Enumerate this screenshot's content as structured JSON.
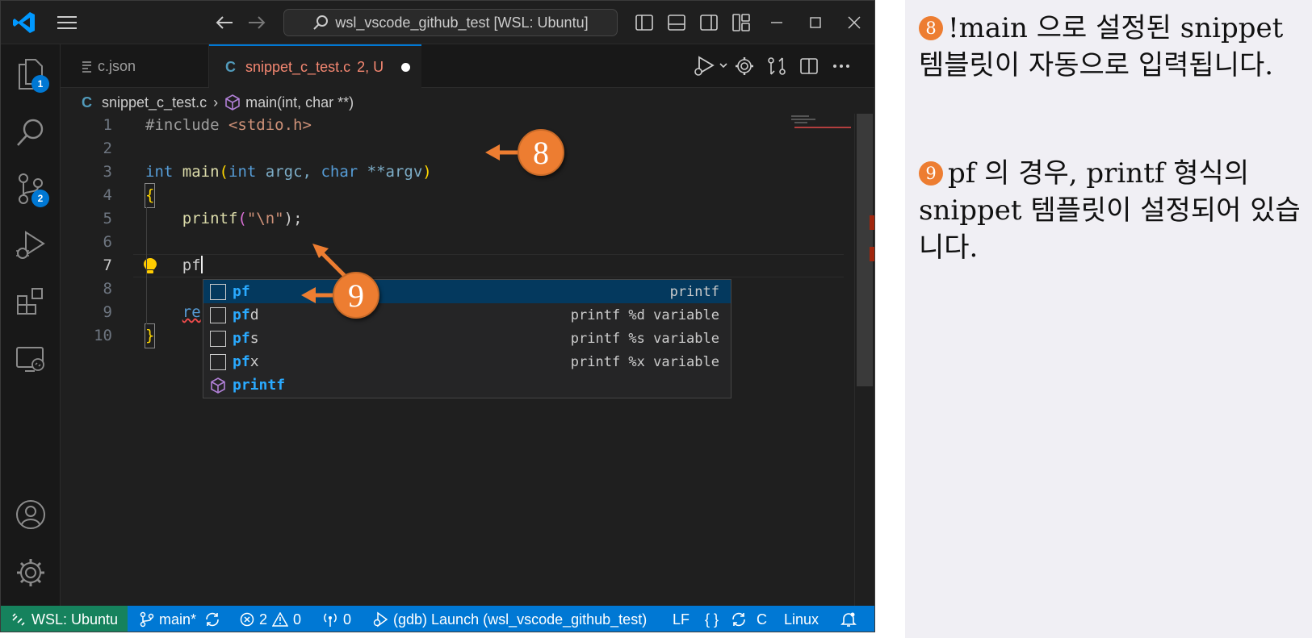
{
  "window": {
    "search_text": "wsl_vscode_github_test [WSL: Ubuntu]"
  },
  "activity": {
    "explorer_badge": "1",
    "scm_badge": "2"
  },
  "tabs": [
    {
      "label": "c.json",
      "icon": "json-file-icon"
    },
    {
      "label": "snippet_c_test.c",
      "status": "2, U",
      "icon": "c-file-icon"
    }
  ],
  "breadcrumb": {
    "file": "snippet_c_test.c",
    "symbol": "main(int, char **)"
  },
  "editor": {
    "line_numbers": [
      "1",
      "2",
      "3",
      "4",
      "5",
      "6",
      "7",
      "8",
      "9",
      "10"
    ],
    "lines": {
      "l1_directive": "#include",
      "l1_header": "<stdio.h>",
      "l3_int": "int",
      "l3_main": "main",
      "l3_params_a": "int",
      "l3_argc": "argc,",
      "l3_char": "char",
      "l3_argv": "**argv",
      "l4": "{",
      "l5_fn": "printf",
      "l5_str": "\"\\n\"",
      "l5_end": ");",
      "l7": "pf",
      "l9": "re",
      "l10": "}"
    }
  },
  "suggest": [
    {
      "match": "pf",
      "rest": "",
      "detail": "printf",
      "icon": "snippet-icon"
    },
    {
      "match": "pf",
      "rest": "d",
      "detail": "printf %d variable",
      "icon": "snippet-icon"
    },
    {
      "match": "pf",
      "rest": "s",
      "detail": "printf %s variable",
      "icon": "snippet-icon"
    },
    {
      "match": "pf",
      "rest": "x",
      "detail": "printf %x variable",
      "icon": "snippet-icon"
    },
    {
      "match": "p",
      "rest": "rintf",
      "detail": "",
      "icon": "cube-icon"
    }
  ],
  "status": {
    "remote": "WSL: Ubuntu",
    "branch": "main*",
    "errors": "2",
    "warnings": "0",
    "ports": "0",
    "debug": "(gdb) Launch (wsl_vscode_github_test)",
    "eol": "LF",
    "braces": "{ }",
    "language": "C",
    "os": "Linux"
  },
  "callouts": {
    "c8": "8",
    "c9": "9"
  },
  "notes": [
    {
      "num": "8",
      "text": "!main 으로 설정된 snippet 템블릿이 자동으로 입력됩니다."
    },
    {
      "num": "9",
      "text": "pf 의 경우, printf 형식의 snippet 템플릿이 설정되어 있습니다."
    }
  ],
  "colors": {
    "accent": "#0078d4",
    "remote": "#16825d",
    "callout": "#ed7d31"
  }
}
